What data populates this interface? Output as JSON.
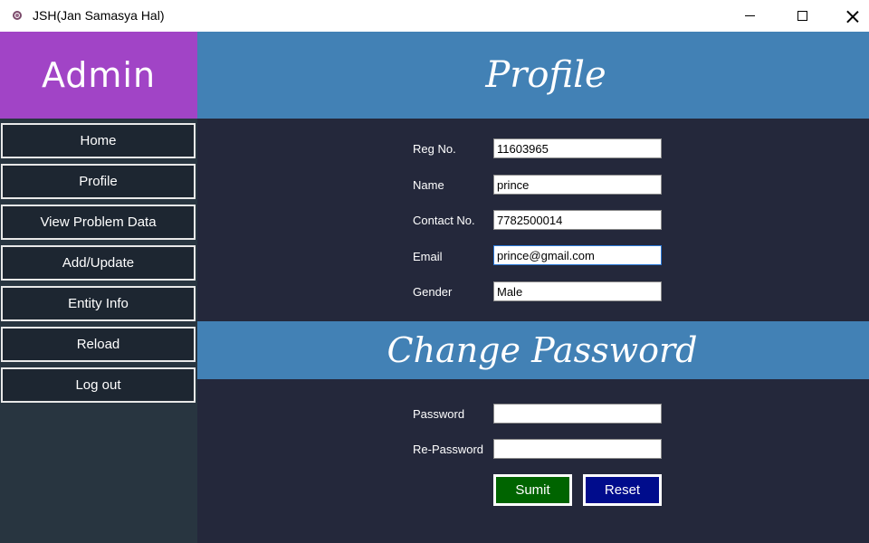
{
  "window": {
    "title": "JSH(Jan Samasya Hal)",
    "icon": "app-icon"
  },
  "sidebar": {
    "header": "Admin",
    "items": [
      {
        "label": "Home"
      },
      {
        "label": "Profile"
      },
      {
        "label": "View Problem Data"
      },
      {
        "label": "Add/Update"
      },
      {
        "label": "Entity Info"
      },
      {
        "label": "Reload"
      },
      {
        "label": "Log out"
      }
    ]
  },
  "profile": {
    "heading": "Profile",
    "fields": [
      {
        "label": "Reg No.",
        "value": "11603965"
      },
      {
        "label": "Name",
        "value": "prince"
      },
      {
        "label": "Contact No.",
        "value": "7782500014"
      },
      {
        "label": "Email",
        "value": "prince@gmail.com"
      },
      {
        "label": "Gender",
        "value": "Male"
      }
    ]
  },
  "change_password": {
    "heading": "Change Password",
    "password_label": "Password",
    "password_value": "",
    "repassword_label": "Re-Password",
    "repassword_value": "",
    "submit_label": "Sumit",
    "reset_label": "Reset"
  },
  "colors": {
    "sidebar_header": "#a144c6",
    "banner": "#4281b5",
    "main_bg": "#24283b",
    "sidebar_bg": "#283540",
    "submit": "#006400",
    "reset": "#000c8c"
  }
}
